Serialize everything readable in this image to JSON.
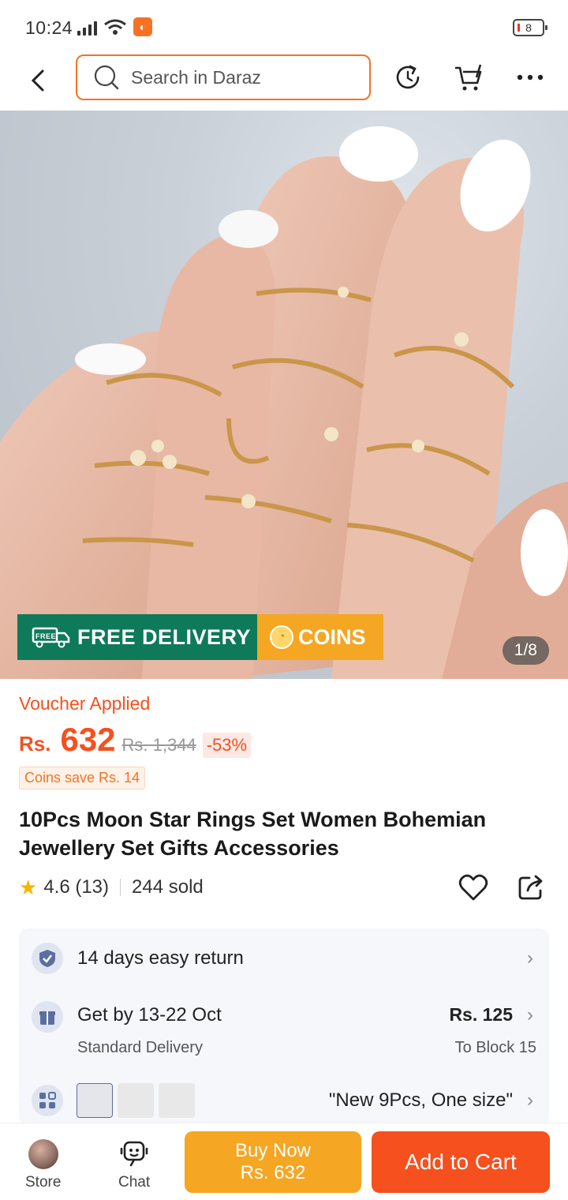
{
  "status_bar": {
    "time": "10:24",
    "battery": "8",
    "icons": [
      "signal-icon",
      "wifi-icon",
      "daraz-app-icon",
      "battery-icon"
    ]
  },
  "header": {
    "search_placeholder": "Search in Daraz",
    "icons": [
      "back-icon",
      "search-icon",
      "history-icon",
      "cart-icon",
      "more-icon"
    ]
  },
  "gallery": {
    "counter": "1/8",
    "badge_free_delivery": "FREE DELIVERY",
    "badge_free_tag": "FREE",
    "badge_coins": "COINS"
  },
  "product": {
    "voucher": "Voucher Applied",
    "currency": "Rs.",
    "price": "632",
    "original_price": "Rs. 1,344",
    "discount": "-53%",
    "coins_save": "Coins save Rs. 14",
    "title": "10Pcs Moon Star Rings Set Women Bohemian Jewellery Set Gifts Accessories",
    "rating": "4.6 (13)",
    "rating_value": 4.6,
    "sold": "244 sold"
  },
  "info": {
    "return_text": "14 days easy return",
    "delivery_title": "Get by 13-22 Oct",
    "delivery_sub": "Standard Delivery",
    "delivery_price": "Rs. 125",
    "delivery_dest": "To Block 15",
    "variant_text": "\"New 9Pcs, One size\"",
    "variant_thumbs": [
      "--",
      "--",
      "--"
    ]
  },
  "bottom_bar": {
    "store_label": "Store",
    "chat_label": "Chat",
    "buy_now_label": "Buy Now",
    "buy_now_price": "Rs. 632",
    "add_to_cart_label": "Add to Cart"
  },
  "colors": {
    "accent_orange": "#f57224",
    "price_red": "#f5501e",
    "buy_now_yellow": "#f5a623",
    "free_delivery_green": "#0e7a5a"
  }
}
